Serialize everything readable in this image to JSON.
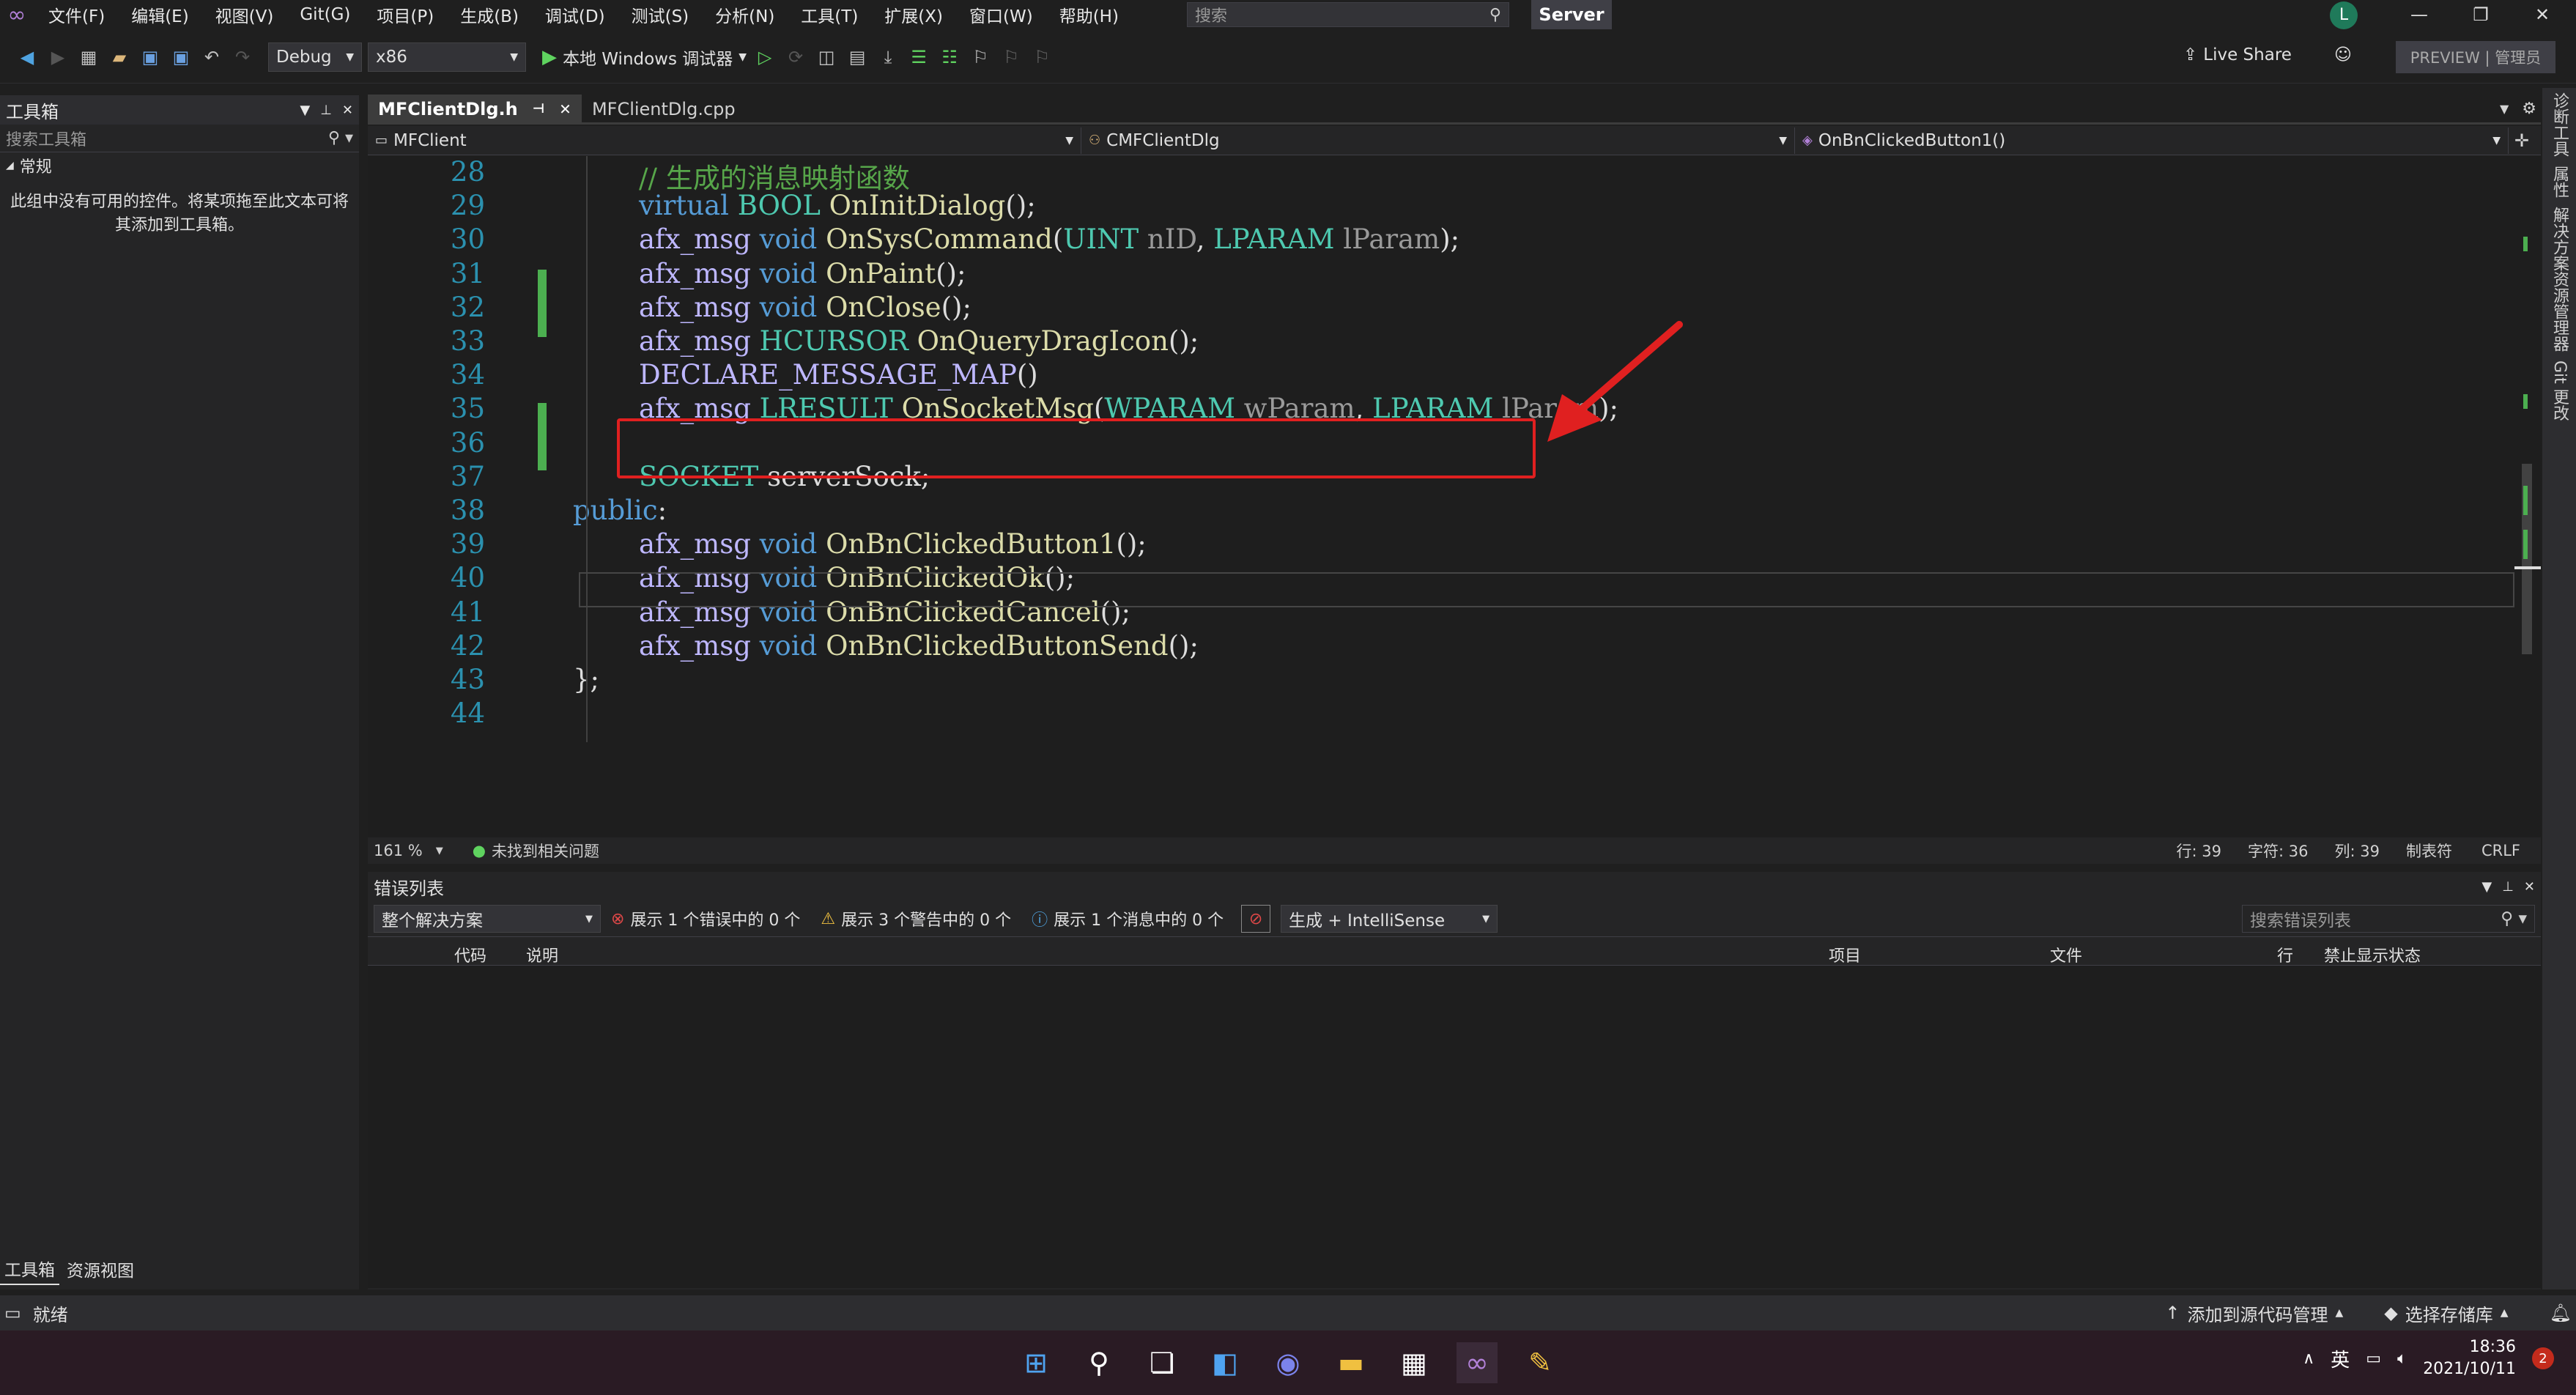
{
  "menu": {
    "items": [
      "文件(F)",
      "编辑(E)",
      "视图(V)",
      "Git(G)",
      "项目(P)",
      "生成(B)",
      "调试(D)",
      "测试(S)",
      "分析(N)",
      "工具(T)",
      "扩展(X)",
      "窗口(W)",
      "帮助(H)"
    ],
    "search_placeholder": "搜索",
    "solution_name": "Server",
    "avatar_letter": "L"
  },
  "toolbar": {
    "config": "Debug",
    "platform": "x86",
    "debugger": "本地 Windows 调试器",
    "live_share": "Live Share",
    "preview": "PREVIEW | 管理员"
  },
  "toolbox": {
    "title": "工具箱",
    "search": "搜索工具箱",
    "group": "常规",
    "empty_text": "此组中没有可用的控件。将某项拖至此文本可将其添加到工具箱。",
    "tabs": [
      "工具箱",
      "资源视图"
    ]
  },
  "editor": {
    "tabs": [
      {
        "label": "MFClientDlg.h",
        "active": true
      },
      {
        "label": "MFClientDlg.cpp",
        "active": false
      }
    ],
    "nav": {
      "project": "MFClient",
      "class": "CMFClientDlg",
      "member": "OnBnClickedButton1()"
    },
    "lines": [
      {
        "n": "28",
        "tokens": [
          {
            "c": "cm",
            "t": "// 生成的消息映射函数"
          }
        ]
      },
      {
        "n": "29",
        "tokens": [
          {
            "c": "kw",
            "t": "virtual "
          },
          {
            "c": "ty",
            "t": "BOOL "
          },
          {
            "c": "fn",
            "t": "OnInitDialog"
          },
          {
            "c": "tx",
            "t": "();"
          }
        ]
      },
      {
        "n": "30",
        "tokens": [
          {
            "c": "mc",
            "t": "afx_msg "
          },
          {
            "c": "kw",
            "t": "void "
          },
          {
            "c": "fn",
            "t": "OnSysCommand"
          },
          {
            "c": "tx",
            "t": "("
          },
          {
            "c": "ty",
            "t": "UINT "
          },
          {
            "c": "pm",
            "t": "nID"
          },
          {
            "c": "tx",
            "t": ", "
          },
          {
            "c": "ty",
            "t": "LPARAM "
          },
          {
            "c": "pm",
            "t": "lParam"
          },
          {
            "c": "tx",
            "t": ");"
          }
        ]
      },
      {
        "n": "31",
        "tokens": [
          {
            "c": "mc",
            "t": "afx_msg "
          },
          {
            "c": "kw",
            "t": "void "
          },
          {
            "c": "fn",
            "t": "OnPaint"
          },
          {
            "c": "tx",
            "t": "();"
          }
        ]
      },
      {
        "n": "32",
        "tokens": [
          {
            "c": "mc",
            "t": "afx_msg "
          },
          {
            "c": "kw",
            "t": "void "
          },
          {
            "c": "fn",
            "t": "OnClose"
          },
          {
            "c": "tx",
            "t": "();"
          }
        ]
      },
      {
        "n": "33",
        "tokens": [
          {
            "c": "mc",
            "t": "afx_msg "
          },
          {
            "c": "ty",
            "t": "HCURSOR "
          },
          {
            "c": "fn",
            "t": "OnQueryDragIcon"
          },
          {
            "c": "tx",
            "t": "();"
          }
        ]
      },
      {
        "n": "34",
        "tokens": [
          {
            "c": "mc",
            "t": "DECLARE_MESSAGE_MAP"
          },
          {
            "c": "tx",
            "t": "()"
          }
        ]
      },
      {
        "n": "35",
        "tokens": [
          {
            "c": "mc",
            "t": "afx_msg "
          },
          {
            "c": "ty",
            "t": "LRESULT "
          },
          {
            "c": "fn",
            "t": "OnSocketMsg"
          },
          {
            "c": "tx",
            "t": "("
          },
          {
            "c": "ty",
            "t": "WPARAM "
          },
          {
            "c": "pm",
            "t": "wParam"
          },
          {
            "c": "tx",
            "t": ", "
          },
          {
            "c": "ty",
            "t": "LPARAM "
          },
          {
            "c": "pm",
            "t": "lParam"
          },
          {
            "c": "tx",
            "t": ");"
          }
        ]
      },
      {
        "n": "36",
        "tokens": []
      },
      {
        "n": "37",
        "tokens": [
          {
            "c": "ty",
            "t": "SOCKET "
          },
          {
            "c": "tx",
            "t": "serverSock;"
          }
        ]
      },
      {
        "n": "38",
        "indent": 0,
        "tokens": [
          {
            "c": "kw",
            "t": "public"
          },
          {
            "c": "tx",
            "t": ":"
          }
        ]
      },
      {
        "n": "39",
        "tokens": [
          {
            "c": "mc",
            "t": "afx_msg "
          },
          {
            "c": "kw",
            "t": "void "
          },
          {
            "c": "fn",
            "t": "OnBnClickedButton1"
          },
          {
            "c": "tx",
            "t": "();"
          }
        ]
      },
      {
        "n": "40",
        "tokens": [
          {
            "c": "mc",
            "t": "afx_msg "
          },
          {
            "c": "kw",
            "t": "void "
          },
          {
            "c": "fn",
            "t": "OnBnClickedOk"
          },
          {
            "c": "tx",
            "t": "();"
          }
        ]
      },
      {
        "n": "41",
        "tokens": [
          {
            "c": "mc",
            "t": "afx_msg "
          },
          {
            "c": "kw",
            "t": "void "
          },
          {
            "c": "fn",
            "t": "OnBnClickedCancel"
          },
          {
            "c": "tx",
            "t": "();"
          }
        ]
      },
      {
        "n": "42",
        "tokens": [
          {
            "c": "mc",
            "t": "afx_msg "
          },
          {
            "c": "kw",
            "t": "void "
          },
          {
            "c": "fn",
            "t": "OnBnClickedButtonSend"
          },
          {
            "c": "tx",
            "t": "();"
          }
        ]
      },
      {
        "n": "43",
        "indent": 0,
        "tokens": [
          {
            "c": "tx",
            "t": "};"
          }
        ]
      },
      {
        "n": "44",
        "tokens": []
      }
    ],
    "status": {
      "zoom": "161 %",
      "issues": "未找到相关问题",
      "line": "行: 39",
      "char": "字符: 36",
      "col": "列: 39",
      "tabs": "制表符",
      "eol": "CRLF"
    }
  },
  "error_list": {
    "title": "错误列表",
    "scope": "整个解决方案",
    "errors": "展示 1 个错误中的 0 个",
    "warnings": "展示 3 个警告中的 0 个",
    "messages": "展示 1 个消息中的 0 个",
    "source": "生成 + IntelliSense",
    "search": "搜索错误列表",
    "columns": {
      "code": "代码",
      "desc": "说明",
      "project": "项目",
      "file": "文件",
      "line": "行",
      "suppress": "禁止显示状态"
    }
  },
  "right_strip": [
    "诊断工具",
    "属性",
    "解决方案资源管理器",
    "Git 更改"
  ],
  "statusbar": {
    "ready": "就绪",
    "add_source": "添加到源代码管理",
    "select_repo": "选择存储库"
  },
  "tray": {
    "lang": "英",
    "time": "18:36",
    "date": "2021/10/11",
    "badge": "2"
  },
  "colors": {
    "accent": "#e02020",
    "change_bar": "#4caf50"
  }
}
